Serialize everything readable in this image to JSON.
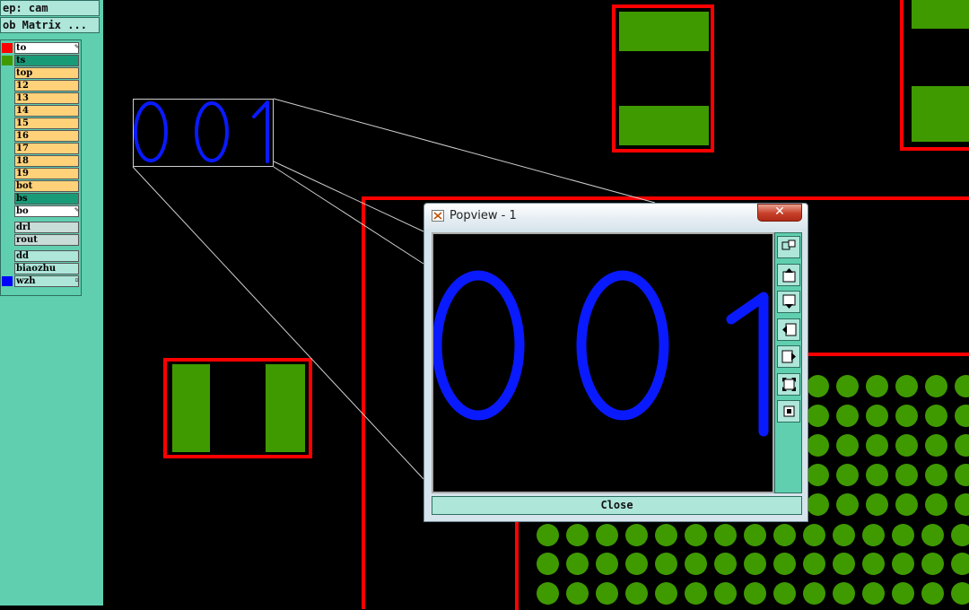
{
  "left_panel": {
    "step_label": "ep: cam",
    "job_matrix_label": "ob Matrix ...",
    "layers": [
      {
        "name": "to",
        "swatch": "#ff0000",
        "bg": "#ffffff",
        "mark": "✎"
      },
      {
        "name": "ts",
        "swatch": "#3f9a00",
        "bg": "#1a9b78",
        "mark": ""
      },
      {
        "name": "top",
        "swatch": "",
        "bg": "#ffd27a",
        "mark": ""
      },
      {
        "name": "12",
        "swatch": "",
        "bg": "#ffd27a",
        "mark": ""
      },
      {
        "name": "13",
        "swatch": "",
        "bg": "#ffd27a",
        "mark": ""
      },
      {
        "name": "14",
        "swatch": "",
        "bg": "#ffd27a",
        "mark": ""
      },
      {
        "name": "15",
        "swatch": "",
        "bg": "#ffd27a",
        "mark": ""
      },
      {
        "name": "16",
        "swatch": "",
        "bg": "#ffd27a",
        "mark": ""
      },
      {
        "name": "17",
        "swatch": "",
        "bg": "#ffd27a",
        "mark": ""
      },
      {
        "name": "18",
        "swatch": "",
        "bg": "#ffd27a",
        "mark": ""
      },
      {
        "name": "19",
        "swatch": "",
        "bg": "#ffd27a",
        "mark": ""
      },
      {
        "name": "bot",
        "swatch": "",
        "bg": "#ffd27a",
        "mark": ""
      },
      {
        "name": "bs",
        "swatch": "",
        "bg": "#1a9b78",
        "mark": ""
      },
      {
        "name": "bo",
        "swatch": "",
        "bg": "#ffffff",
        "mark": "✎"
      },
      {
        "name": "drl",
        "swatch": "",
        "bg": "#c8dcd8",
        "mark": ""
      },
      {
        "name": "rout",
        "swatch": "",
        "bg": "#c8dcd8",
        "mark": ""
      },
      {
        "name": "dd",
        "swatch": "",
        "bg": "#aee6da",
        "mark": ""
      },
      {
        "name": "biaozhu",
        "swatch": "",
        "bg": "#aee6da",
        "mark": ""
      },
      {
        "name": "wzh",
        "swatch": "#0000ff",
        "bg": "#aee6da",
        "mark": "▫"
      }
    ]
  },
  "canvas": {
    "magnified_text": "001",
    "text_color": "#0a1aff"
  },
  "popview": {
    "title": "Popview - 1",
    "close_x": "✕",
    "close_button_label": "Close",
    "zoomed_text": "001",
    "tools": [
      "zoom-window-icon",
      "zoom-in-icon",
      "zoom-out-icon",
      "pan-left-icon",
      "pan-right-icon",
      "fit-screen-icon",
      "home-view-icon"
    ]
  },
  "colors": {
    "panel": "#5fcfb0",
    "outline_red": "#ff0000",
    "pad_green": "#3f9a00",
    "text_blue": "#0a1aff"
  }
}
